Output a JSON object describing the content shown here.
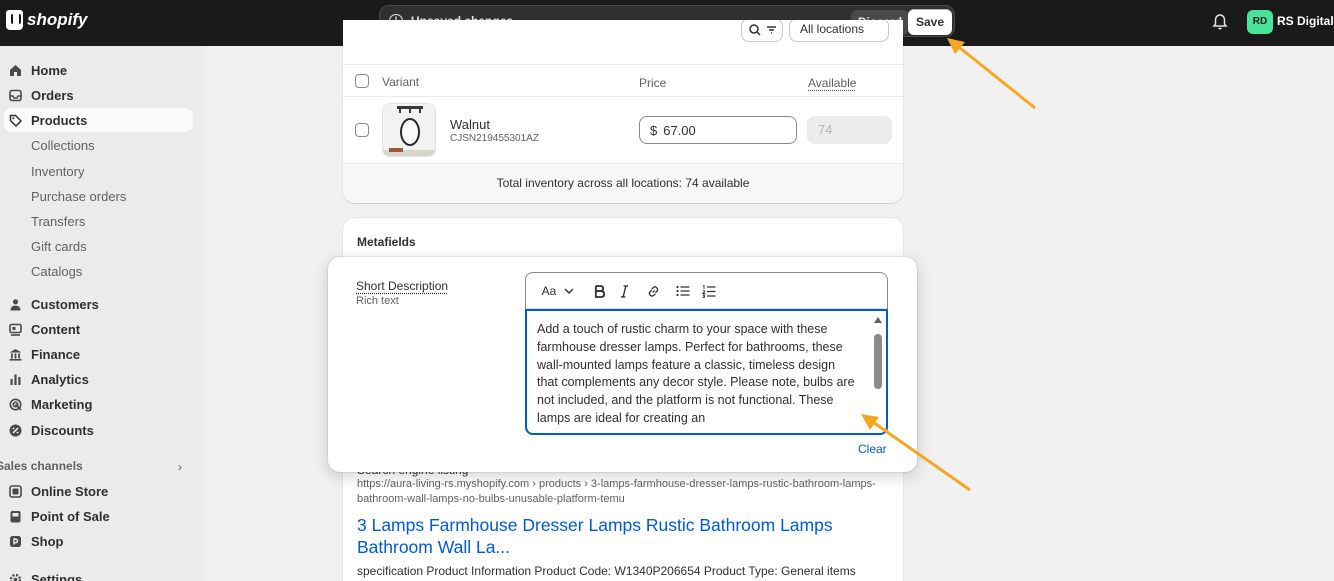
{
  "app": {
    "logo_text": "shopify"
  },
  "topbar": {
    "unsaved_text": "Unsaved changes",
    "discard_label": "Discard",
    "save_label": "Save",
    "avatar_initials": "RD",
    "store_name": "RS Digitals"
  },
  "sidebar": {
    "items": [
      {
        "label": "Home",
        "icon": "home-icon"
      },
      {
        "label": "Orders",
        "icon": "inbox-icon"
      },
      {
        "label": "Products",
        "icon": "tag-icon",
        "active": true
      }
    ],
    "product_subitems": [
      "Collections",
      "Inventory",
      "Purchase orders",
      "Transfers",
      "Gift cards",
      "Catalogs"
    ],
    "items2": [
      {
        "label": "Customers",
        "icon": "person-icon"
      },
      {
        "label": "Content",
        "icon": "content-icon"
      },
      {
        "label": "Finance",
        "icon": "bank-icon"
      },
      {
        "label": "Analytics",
        "icon": "bar-chart-icon"
      },
      {
        "label": "Marketing",
        "icon": "target-icon"
      },
      {
        "label": "Discounts",
        "icon": "discount-icon"
      }
    ],
    "sales_channels_label": "Sales channels",
    "channels": [
      {
        "label": "Online Store",
        "icon": "store-icon"
      },
      {
        "label": "Point of Sale",
        "icon": "pos-icon"
      },
      {
        "label": "Shop",
        "icon": "shop-icon"
      }
    ],
    "settings_label": "Settings"
  },
  "variants": {
    "columns": {
      "variant": "Variant",
      "price": "Price",
      "available": "Available"
    },
    "filter_label": "All locations",
    "row": {
      "name": "Walnut",
      "sku": "CJSN219455301AZ",
      "currency": "$",
      "price": "67.00",
      "available": "74"
    },
    "total_inventory": "Total inventory across all locations: 74 available"
  },
  "metafields": {
    "title": "Metafields",
    "field_name": "Short Description",
    "field_type": "Rich text",
    "toolbar": {
      "format_label": "Aa"
    },
    "content": "Add a touch of rustic charm to your space with these farmhouse dresser lamps. Perfect for bathrooms, these wall-mounted lamps feature a classic, timeless design that complements any decor style. Please note, bulbs are not included, and the platform is not functional. These lamps are ideal for creating an",
    "clear_label": "Clear"
  },
  "seo": {
    "label": "Search engine listing",
    "url": "https://aura-living-rs.myshopify.com › products › 3-lamps-farmhouse-dresser-lamps-rustic-bathroom-lamps-bathroom-wall-lamps-no-bulbs-unusable-platform-temu",
    "title": "3 Lamps Farmhouse Dresser Lamps Rustic Bathroom Lamps Bathroom Wall La...",
    "description": "specification Product Information Product Code: W1340P206654 Product Type: General items"
  },
  "colors": {
    "accent": "#005bd3",
    "annotation_arrow": "#f5a623",
    "topbar": "#1a1a1a",
    "avatar": "#4ae39a"
  }
}
